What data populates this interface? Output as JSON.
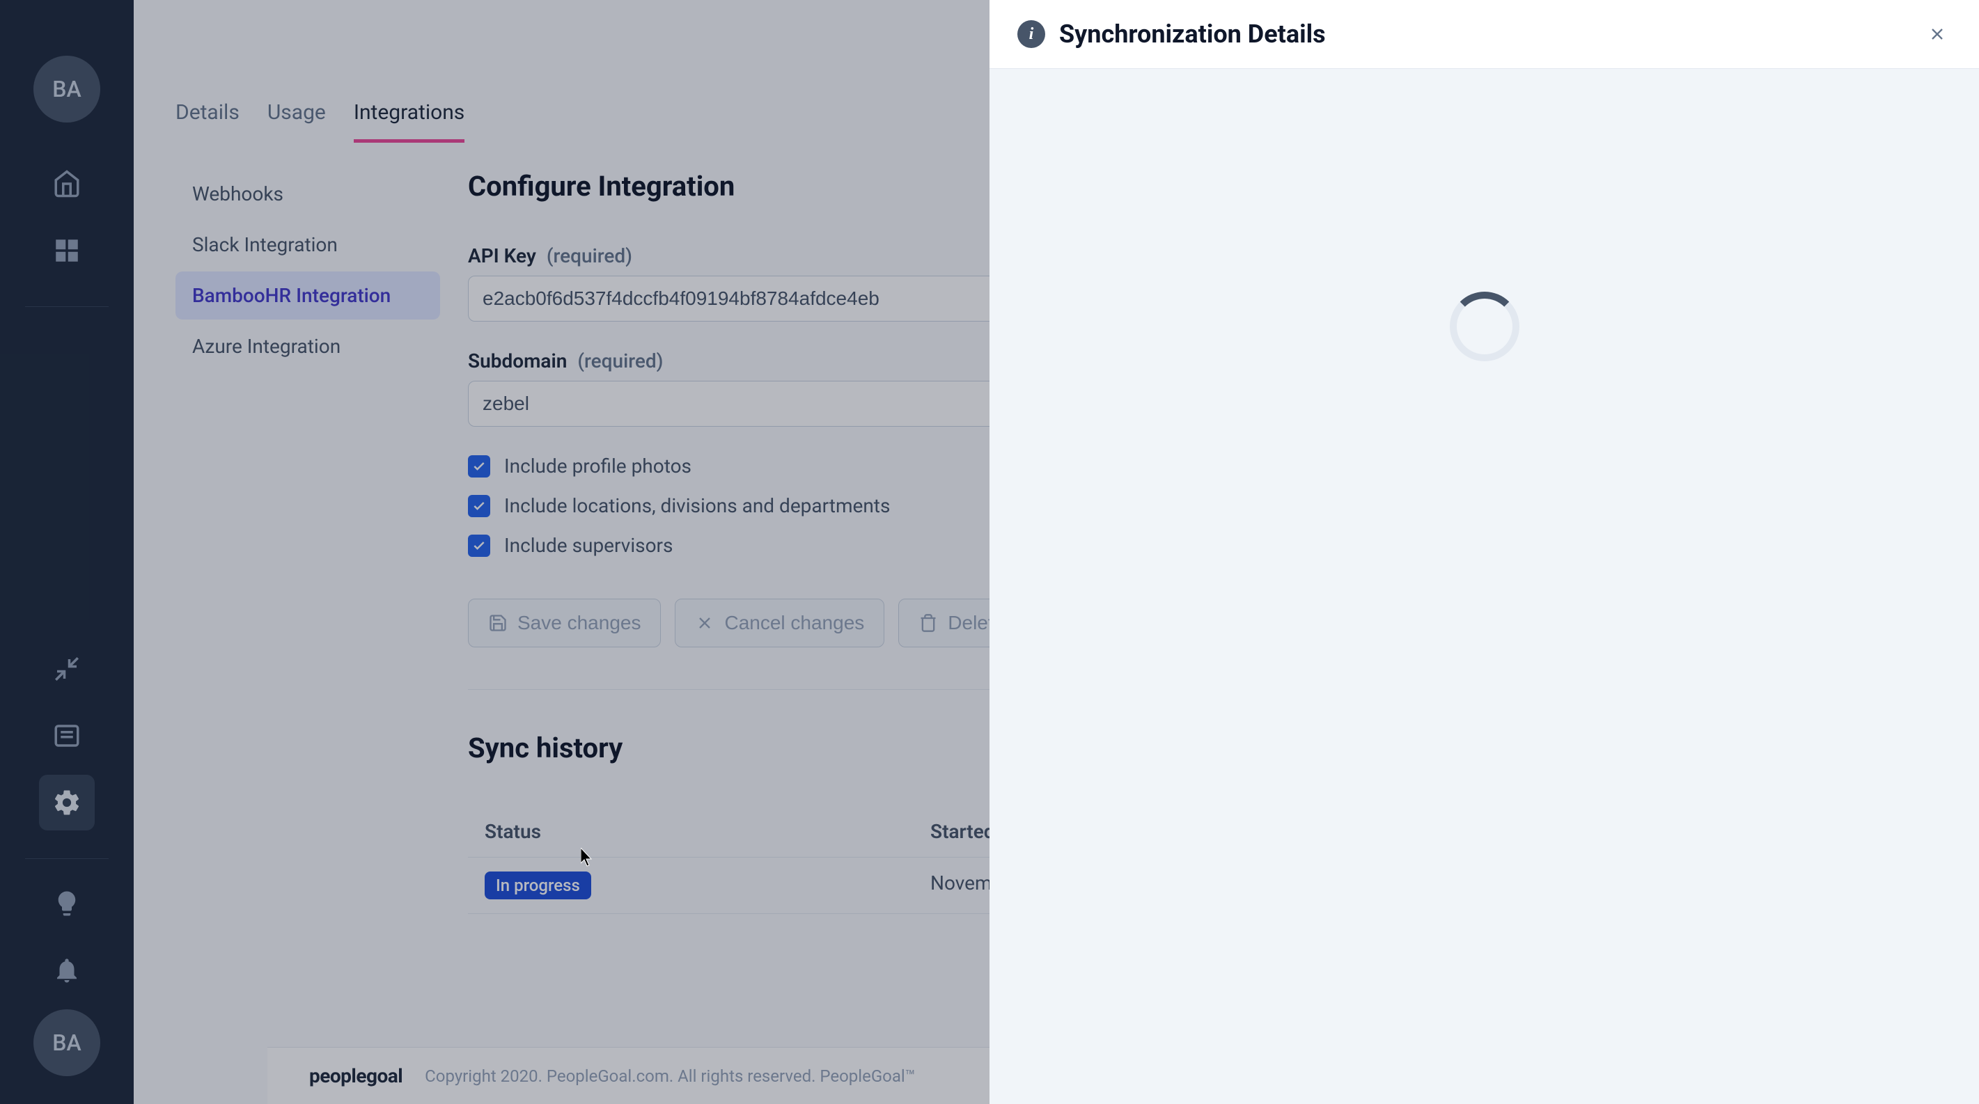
{
  "sidebar": {
    "avatar_initials": "BA"
  },
  "tabs": {
    "details": "Details",
    "usage": "Usage",
    "integrations": "Integrations"
  },
  "integration_menu": {
    "webhooks": "Webhooks",
    "slack": "Slack Integration",
    "bamboo": "BambooHR Integration",
    "azure": "Azure Integration"
  },
  "configure": {
    "title": "Configure Integration",
    "api_key_label": "API Key",
    "required": "(required)",
    "api_key_value": "e2acb0f6d537f4dccfb4f09194bf8784afdce4eb",
    "subdomain_label": "Subdomain",
    "subdomain_value": "zebel",
    "include_photos": "Include profile photos",
    "include_locations": "Include locations, divisions and departments",
    "include_supervisors": "Include supervisors",
    "save_label": "Save changes",
    "cancel_label": "Cancel changes",
    "delete_label": "Delete"
  },
  "sync": {
    "title": "Sync history",
    "col_status": "Status",
    "col_started": "Started",
    "rows": [
      {
        "status": "In progress",
        "started": "November"
      }
    ]
  },
  "footer": {
    "logo": "peoplegoal",
    "copyright": "Copyright 2020. PeopleGoal.com. All rights reserved. PeopleGoal™"
  },
  "drawer": {
    "title": "Synchronization Details"
  }
}
